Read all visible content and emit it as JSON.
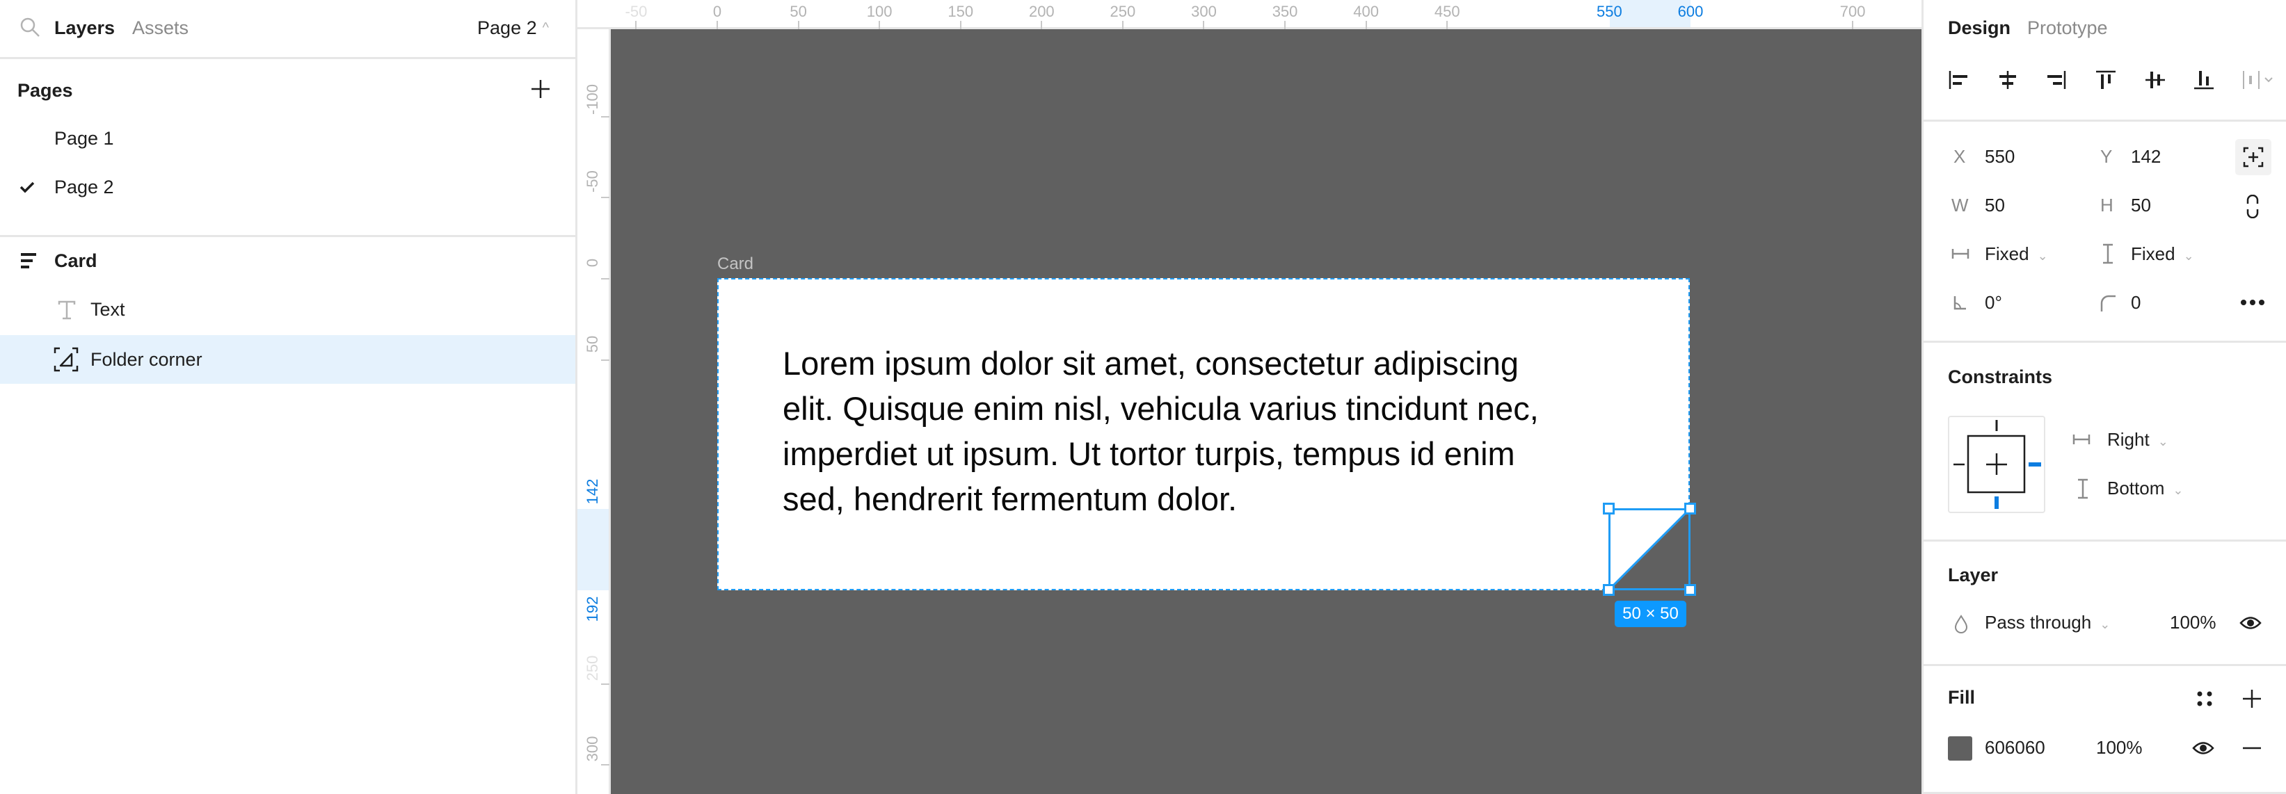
{
  "left_panel": {
    "tabs": [
      {
        "label": "Layers",
        "active": true
      },
      {
        "label": "Assets",
        "active": false
      }
    ],
    "current_page": "Page 2",
    "pages_title": "Pages",
    "pages": [
      {
        "label": "Page 1",
        "selected": false
      },
      {
        "label": "Page 2",
        "selected": true
      }
    ],
    "layers": [
      {
        "label": "Card",
        "icon": "frame-autolayout-icon",
        "level": 0,
        "selected": false
      },
      {
        "label": "Text",
        "icon": "text-icon",
        "level": 1,
        "selected": false
      },
      {
        "label": "Folder corner",
        "icon": "vector-triangle-icon",
        "level": 1,
        "selected": true
      }
    ]
  },
  "rulers": {
    "top": [
      "-50",
      "0",
      "50",
      "100",
      "150",
      "200",
      "250",
      "300",
      "350",
      "400",
      "450",
      "550",
      "600",
      "700"
    ],
    "top_highlight": [
      "550",
      "600"
    ],
    "left": [
      "-100",
      "-50",
      "0",
      "50",
      "142",
      "192",
      "250",
      "300"
    ],
    "left_highlight": [
      "142",
      "192"
    ]
  },
  "canvas": {
    "frame_label": "Card",
    "card_text": "Lorem ipsum dolor sit amet, consectetur adipiscing elit. Quisque enim nisl, vehicula varius tincidunt nec, imperdiet ut ipsum. Ut tortor turpis, tempus id enim sed, hendrerit fermentum dolor.",
    "card_text_lines": [
      "Lorem ipsum dolor sit amet, consectetur adipiscing",
      "elit. Quisque enim nisl, vehicula varius tincidunt nec,",
      "imperdiet ut ipsum. Ut tortor turpis, tempus id enim",
      "sed, hendrerit fermentum dolor."
    ],
    "selection_size": "50 × 50",
    "background_color": "#606060",
    "selection_color": "#0d99ff"
  },
  "right_panel": {
    "tabs": [
      {
        "label": "Design",
        "active": true
      },
      {
        "label": "Prototype",
        "active": false
      }
    ],
    "align_icons": [
      "align-left-icon",
      "align-horizontal-center-icon",
      "align-right-icon",
      "align-top-icon",
      "align-vertical-center-icon",
      "align-bottom-icon",
      "distribute-icon"
    ],
    "position": {
      "x_label": "X",
      "x": "550",
      "y_label": "Y",
      "y": "142"
    },
    "size": {
      "w_label": "W",
      "w": "50",
      "h_label": "H",
      "h": "50"
    },
    "resizing": {
      "horizontal": "Fixed",
      "vertical": "Fixed"
    },
    "rotation": "0°",
    "corner_radius": "0",
    "constraints": {
      "title": "Constraints",
      "horizontal": "Right",
      "vertical": "Bottom"
    },
    "layer": {
      "title": "Layer",
      "blend_mode": "Pass through",
      "opacity": "100%"
    },
    "fill": {
      "title": "Fill",
      "color_hex": "606060",
      "swatch": "#606060",
      "opacity": "100%"
    }
  }
}
